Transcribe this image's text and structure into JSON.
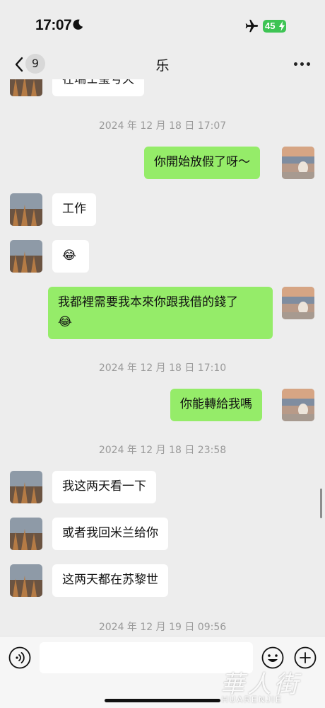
{
  "status_bar": {
    "time": "17:07",
    "battery": "45"
  },
  "nav": {
    "unread_count": "9",
    "title": "乐"
  },
  "messages": {
    "m0": "在瑞士玺号天",
    "t1": "2024 年 12 月 18 日 17:07",
    "m1": "你開始放假了呀～",
    "m2": "工作",
    "m3": "😂",
    "m4_line1": "我都裡需要我本來你跟我借的錢了",
    "m4_line2": "😂",
    "t2": "2024 年 12 月 18 日 17:10",
    "m5": "你能轉給我嗎",
    "t3": "2024 年 12 月 18 日 23:58",
    "m6": "我这两天看一下",
    "m7": "或者我回米兰给你",
    "m8": "这两天都在苏黎世",
    "t4": "2024 年 12 月 19 日 09:56"
  },
  "watermark": {
    "glyphs": "華人街",
    "sub": "HUARENJIE"
  },
  "icons": {
    "moon": "moon-icon",
    "airplane": "airplane-icon",
    "back": "chevron-left-icon",
    "more": "more-icon",
    "voice": "voice-icon",
    "emoji": "emoji-icon",
    "plus": "plus-icon"
  },
  "colors": {
    "background": "#ededed",
    "outgoing_bubble": "#95ec69",
    "incoming_bubble": "#ffffff",
    "battery": "#3ec454",
    "timestamp": "#9a9a9a"
  }
}
